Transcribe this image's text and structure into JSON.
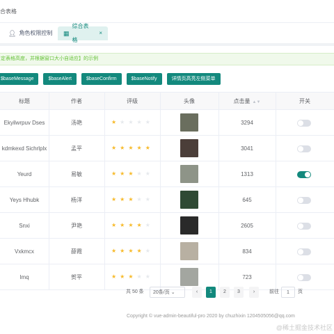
{
  "breadcrumb": "合表格",
  "tabs": [
    {
      "label": "角色权限控制",
      "icon": "user-icon"
    },
    {
      "label": "综合表格",
      "icon": "table-icon",
      "close": "×"
    }
  ],
  "alert": "定表格高度，并根据窗口大小自适应】的示例",
  "buttons": [
    "$baseMessage",
    "$baseAlert",
    "$baseConfirm",
    "$baseNotify",
    "详情页高亮左侧菜单"
  ],
  "columns": [
    "标题",
    "作者",
    "评级",
    "头像",
    "点击量",
    "开关"
  ],
  "rows": [
    {
      "title": "Ekyilwrpuv Dses",
      "author": "汤艳",
      "rating": 1,
      "clicks": "3294",
      "on": false,
      "img": "#6a6e5e"
    },
    {
      "title": "kdmkexd Sichrlplx",
      "author": "孟平",
      "rating": 5,
      "clicks": "3041",
      "on": false,
      "img": "#4b3e39"
    },
    {
      "title": "Yeurd",
      "author": "易敏",
      "rating": 3,
      "clicks": "1313",
      "on": true,
      "img": "#8e9488"
    },
    {
      "title": "Yeys Hhubk",
      "author": "杨洋",
      "rating": 3,
      "clicks": "645",
      "on": false,
      "img": "#2f4a34"
    },
    {
      "title": "Snxi",
      "author": "尹艳",
      "rating": 4,
      "clicks": "2605",
      "on": false,
      "img": "#2a2a2a"
    },
    {
      "title": "Vxkmcx",
      "author": "薛霞",
      "rating": 4,
      "clicks": "834",
      "on": false,
      "img": "#b8b0a2"
    },
    {
      "title": "Imq",
      "author": "贺平",
      "rating": 3,
      "clicks": "723",
      "on": false,
      "img": "#a3a6a0"
    }
  ],
  "pagination": {
    "total": "共 50 条",
    "page_size": "20条/页",
    "prev": "‹",
    "pages": [
      "1",
      "2",
      "3"
    ],
    "current": "1",
    "next": "›",
    "goto_label": "前往",
    "goto_value": "1",
    "goto_suffix": "页"
  },
  "footer": "Copyright © vue-admin-beautiful-pro 2020 by chuzhixin 1204505056@qq.com",
  "watermark": "@稀土掘金技术社区",
  "colors": {
    "accent": "#13897d",
    "star": "#f7ba2a"
  }
}
